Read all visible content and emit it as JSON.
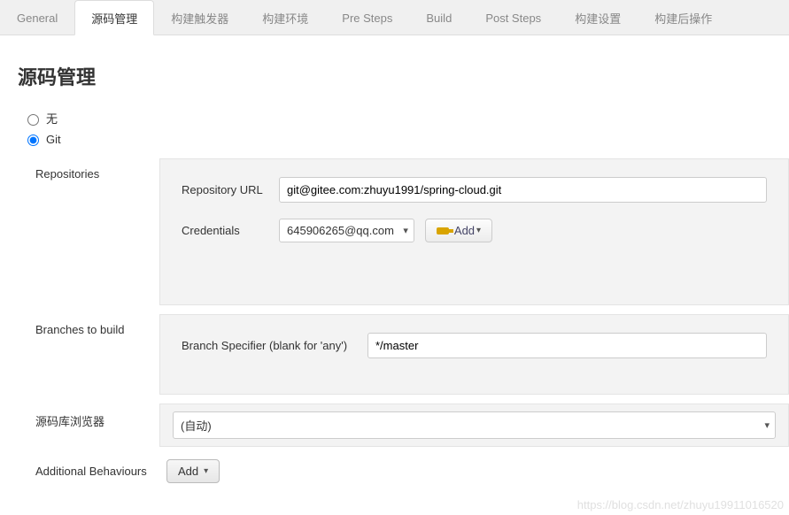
{
  "tabs": [
    "General",
    "源码管理",
    "构建触发器",
    "构建环境",
    "Pre Steps",
    "Build",
    "Post Steps",
    "构建设置",
    "构建后操作"
  ],
  "active_tab_index": 1,
  "section_title": "源码管理",
  "scm_options": {
    "none_label": "无",
    "git_label": "Git",
    "selected": "git"
  },
  "repositories": {
    "side_label": "Repositories",
    "url_label": "Repository URL",
    "url_value": "git@gitee.com:zhuyu1991/spring-cloud.git",
    "credentials_label": "Credentials",
    "credentials_value": "645906265@qq.com",
    "add_label": "Add"
  },
  "branches": {
    "side_label": "Branches to build",
    "specifier_label": "Branch Specifier (blank for 'any')",
    "specifier_value": "*/master"
  },
  "browser": {
    "side_label": "源码库浏览器",
    "value": "(自动)"
  },
  "additional": {
    "side_label": "Additional Behaviours",
    "add_label": "Add"
  },
  "watermark": "https://blog.csdn.net/zhuyu19911016520"
}
